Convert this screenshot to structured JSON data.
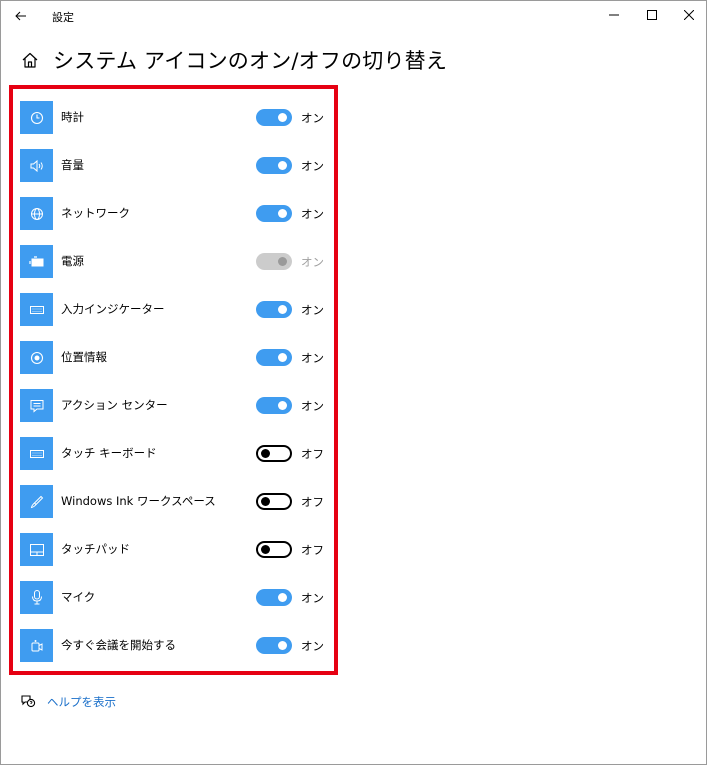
{
  "window": {
    "app_title": "設定",
    "controls": [
      "minimize-icon",
      "maximize-icon",
      "close-icon"
    ]
  },
  "header": {
    "title": "システム アイコンのオン/オフの切り替え",
    "home_icon": "home-icon",
    "back_icon": "back-arrow-icon"
  },
  "colors": {
    "accent": "#3f9cf0",
    "highlight_border": "#e60012",
    "disabled_toggle": "#cccccc",
    "link": "#1a6fc9"
  },
  "items": [
    {
      "label": "時計",
      "icon": "clock-icon",
      "state": "on",
      "state_label": "オン"
    },
    {
      "label": "音量",
      "icon": "volume-icon",
      "state": "on",
      "state_label": "オン"
    },
    {
      "label": "ネットワーク",
      "icon": "globe-icon",
      "state": "on",
      "state_label": "オン"
    },
    {
      "label": "電源",
      "icon": "battery-icon",
      "state": "disabled",
      "state_label": "オン"
    },
    {
      "label": "入力インジケーター",
      "icon": "keyboard-icon",
      "state": "on",
      "state_label": "オン"
    },
    {
      "label": "位置情報",
      "icon": "location-icon",
      "state": "on",
      "state_label": "オン"
    },
    {
      "label": "アクション センター",
      "icon": "action-center-icon",
      "state": "on",
      "state_label": "オン"
    },
    {
      "label": "タッチ キーボード",
      "icon": "touch-keyboard-icon",
      "state": "off",
      "state_label": "オフ"
    },
    {
      "label": "Windows Ink ワークスペース",
      "icon": "pen-icon",
      "state": "off",
      "state_label": "オフ"
    },
    {
      "label": "タッチパッド",
      "icon": "touchpad-icon",
      "state": "off",
      "state_label": "オフ"
    },
    {
      "label": "マイク",
      "icon": "microphone-icon",
      "state": "on",
      "state_label": "オン"
    },
    {
      "label": "今すぐ会議を開始する",
      "icon": "meet-now-icon",
      "state": "on",
      "state_label": "オン"
    }
  ],
  "help": {
    "label": "ヘルプを表示",
    "icon": "help-chat-icon"
  }
}
